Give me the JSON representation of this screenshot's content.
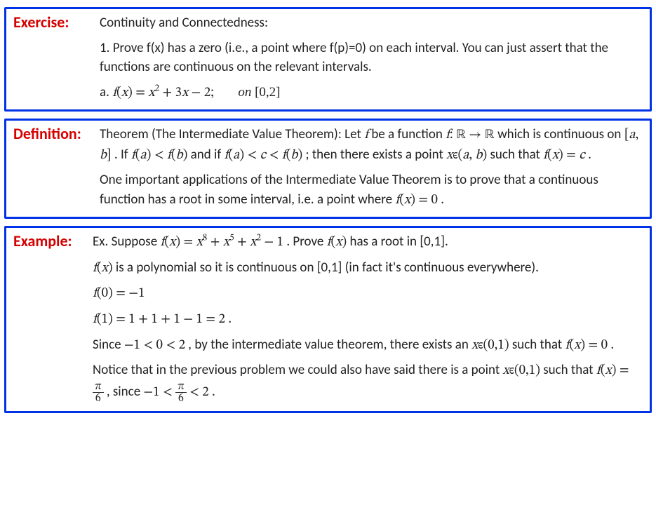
{
  "exercise": {
    "label": "Exercise:",
    "title": "Continuity and Connectedness:",
    "item1": "1.  Prove f(x) has a zero (i.e., a point where f(p)=0) on each interval.  You can just assert that the functions are continuous on the relevant intervals.",
    "item_a_prefix": "a.   ",
    "item_a_math": "f(x) = x² + 3x − 2;",
    "item_a_on": "on  [0,2]"
  },
  "definition": {
    "label": "Definition:",
    "line1_a": "Theorem (The Intermediate Value Theorem):  Let ",
    "line1_b": " be a function ",
    "line1_c": " which is continuous on ",
    "line1_d": ".  If ",
    "line1_e": " and if ",
    "line1_f": ";  then there exists a point ",
    "line1_g": " such that ",
    "line1_h": ".",
    "f": "f",
    "map": "f: ℝ → ℝ",
    "ab": "[a, b]",
    "ineq1": "f(a) < f(b)",
    "ineq2": "f(a) < c < f(b)",
    "pt": "xϵ(a, b)",
    "eqc": "f(x) = c",
    "line2_a": "One important applications of the Intermediate Value Theorem is to prove that a continuous function has a root in some interval, i.e. a point where ",
    "eq0": "f(x) = 0",
    "line2_b": "."
  },
  "example": {
    "label": "Example:",
    "l1a": "Ex.  Suppose ",
    "l1m": "f(x) = x⁸ + x⁵ + x² − 1",
    "l1b": ".  Prove ",
    "l1fx": "f(x)",
    "l1c": " has a root in [0,1].",
    "l2a": "",
    "l2fx": "f(x)",
    "l2b": " is a polynomial so it is continuous on [0,1] (in fact it's continuous everywhere).",
    "l3": "f(0) = −1",
    "l4": "f(1) = 1 + 1 + 1 − 1 = 2 .",
    "l5a": "Since ",
    "l5m": "−1 < 0 < 2",
    "l5b": ", by the intermediate value theorem, there exists an ",
    "l5pt": "xϵ(0,1)",
    "l5c": " such that ",
    "l5eq": "f(x) = 0",
    "l5d": ".",
    "l6a": "Notice that in the previous problem we could also have said there is a point ",
    "l6pt": "xϵ(0,1)",
    "l6b": " such that ",
    "l6eq_pre": "f(x) = ",
    "pi": "π",
    "six": "6",
    "l6c": ", since  ",
    "l6ineq_pre": "−1 < ",
    "l6ineq_post": " < 2",
    "l6d": "."
  }
}
